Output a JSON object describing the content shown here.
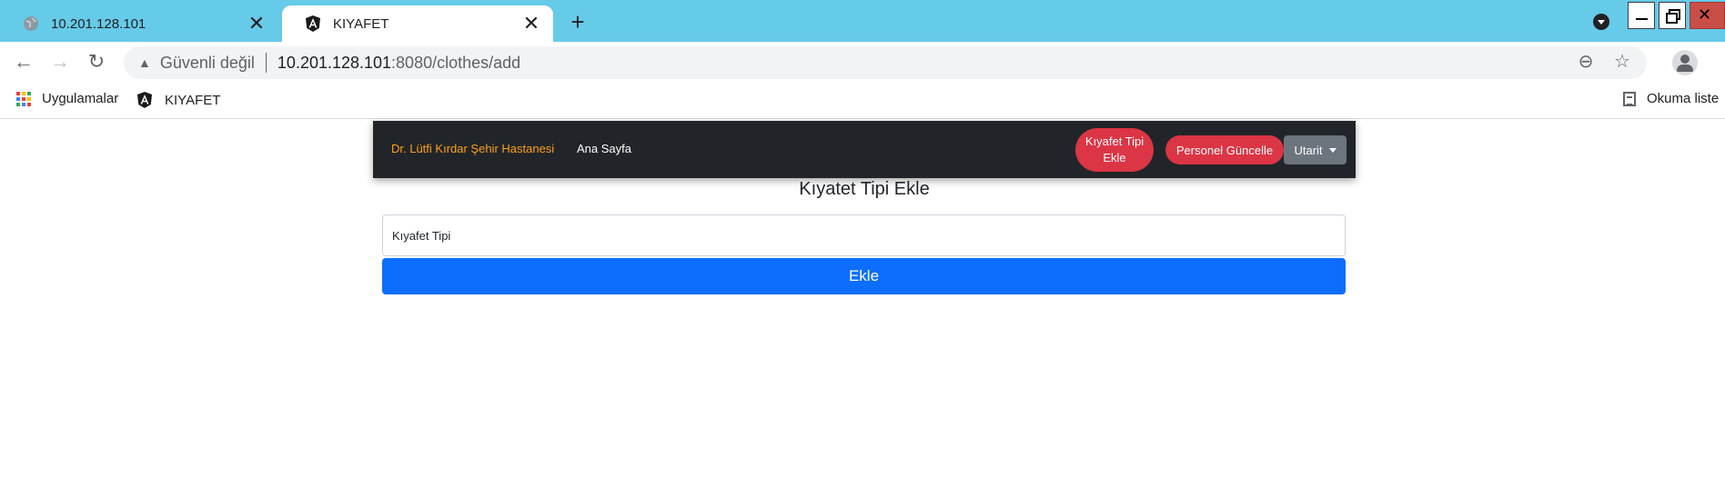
{
  "browser": {
    "tabs": [
      {
        "title": "10.201.128.101",
        "icon": "globe-icon",
        "active": false
      },
      {
        "title": "KIYAFET",
        "icon": "angular-icon",
        "active": true
      }
    ],
    "new_tab_label": "+",
    "address": {
      "security_label": "Güvenli değil",
      "host": "10.201.128.101",
      "path": ":8080/clothes/add"
    },
    "bookmarks": [
      {
        "label": "Uygulamalar",
        "icon": "apps-grid-icon"
      },
      {
        "label": "KIYAFET",
        "icon": "angular-icon"
      }
    ],
    "reading_list_label": "Okuma liste"
  },
  "navbar": {
    "brand": "Dr. Lütfi Kırdar Şehir Hastanesi",
    "home": "Ana Sayfa",
    "add_clothes_type": "Kıyafet Tipi Ekle",
    "update_personnel": "Personel Güncelle",
    "dropdown": "Utarit"
  },
  "form": {
    "title": "Kıyatet Tipi Ekle",
    "placeholder": "Kıyafet Tipi",
    "submit_label": "Ekle"
  },
  "colors": {
    "tabstrip": "#66cae9",
    "navbar_bg": "#212529",
    "brand": "#ff9f1c",
    "danger": "#dc3545",
    "secondary": "#6c757d",
    "primary": "#0d6efd"
  }
}
